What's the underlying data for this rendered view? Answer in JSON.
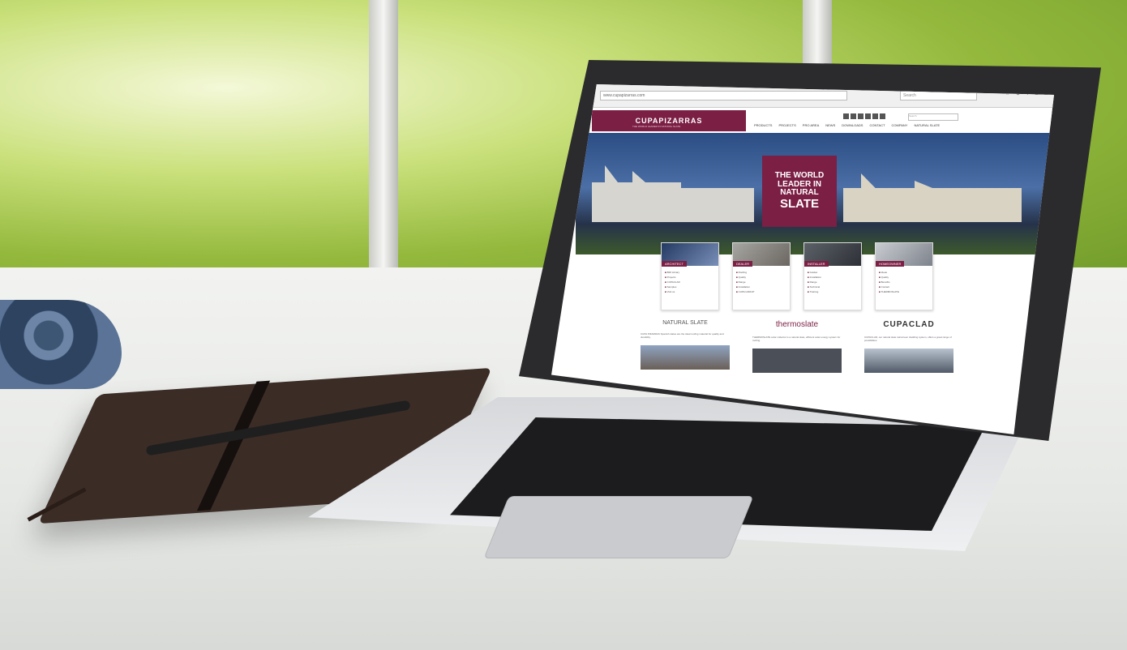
{
  "browser": {
    "url": "www.cupapizarras.com",
    "search_placeholder": "Search",
    "toolbar_icons": "☆ ⊕ ↓ ⌂ ☰"
  },
  "site": {
    "logo": "CUPAPIZARRAS",
    "logo_tagline": "THE WORLD LEADER IN NATURAL SLATE",
    "search_placeholder": "Search",
    "nav": [
      "PRODUCTS",
      "PROJECTS",
      "PRO AREA",
      "NEWS",
      "DOWNLOADS",
      "CONTACT",
      "COMPANY",
      "NATURAL SLATE"
    ]
  },
  "hero": {
    "line1": "THE WORLD",
    "line2": "LEADER IN",
    "line3": "NATURAL",
    "line4": "SLATE"
  },
  "cards": [
    {
      "title": "ARCHITECT",
      "items": [
        "BIM Library",
        "Projects",
        "CUPACLAD",
        "Samples",
        "Visit us"
      ]
    },
    {
      "title": "DEALER",
      "items": [
        "Roofing",
        "Quality",
        "Range",
        "Installation",
        "CUPA GROUP"
      ]
    },
    {
      "title": "INSTALLER",
      "items": [
        "Guides",
        "Installation",
        "Range",
        "Technical",
        "Training"
      ]
    },
    {
      "title": "HOMEOWNER",
      "items": [
        "Ideas",
        "Quality",
        "Benefits",
        "Contact",
        "THERMOSLATE"
      ]
    }
  ],
  "columns": [
    {
      "title": "NATURAL SLATE",
      "text": "CUPA PIZARRAS Spanish slates are the ideal roofing material for quality and durability."
    },
    {
      "title": "thermoslate",
      "text": "THERMOSLATE solar collector is a natural slate, efficient solar energy system for roofing."
    },
    {
      "title": "CUPACLAD",
      "text": "CUPACLAD, our natural slate rainscreen cladding system, offers a great range of possibilities."
    }
  ]
}
